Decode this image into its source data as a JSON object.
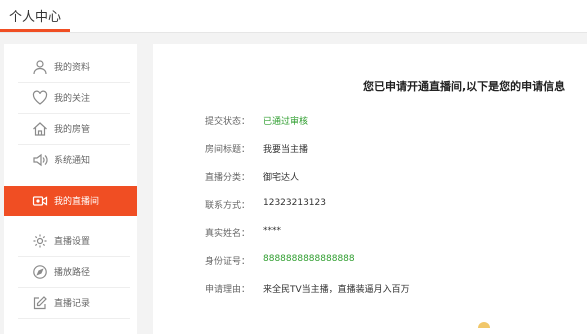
{
  "header": {
    "title": "个人中心"
  },
  "sidebar": {
    "items": [
      {
        "label": "我的资料",
        "icon": "user-icon"
      },
      {
        "label": "我的关注",
        "icon": "heart-icon"
      },
      {
        "label": "我的房管",
        "icon": "home-icon"
      },
      {
        "label": "系统通知",
        "icon": "speaker-icon"
      },
      {
        "label": "我的直播间",
        "icon": "video-icon",
        "active": true
      },
      {
        "label": "直播设置",
        "icon": "gear-icon"
      },
      {
        "label": "播放路径",
        "icon": "compass-icon"
      },
      {
        "label": "直播记录",
        "icon": "edit-icon"
      }
    ]
  },
  "main": {
    "heading": "您已申请开通直播间,以下是您的申请信息",
    "fields": [
      {
        "label": "提交状态：",
        "value": "已通过审核",
        "status": "success"
      },
      {
        "label": "房间标题：",
        "value": "我要当主播"
      },
      {
        "label": "直播分类：",
        "value": "御宅达人"
      },
      {
        "label": "联系方式：",
        "value": "12323213123"
      },
      {
        "label": "真实姓名：",
        "value": "****"
      },
      {
        "label": "身份证号：",
        "value": "8888888888888888",
        "status": "success"
      },
      {
        "label": "申请理由：",
        "value": "来全民TV当主播，直播装逼月入百万"
      }
    ]
  },
  "colors": {
    "accent": "#f04e23",
    "success": "#2f9e2f"
  }
}
